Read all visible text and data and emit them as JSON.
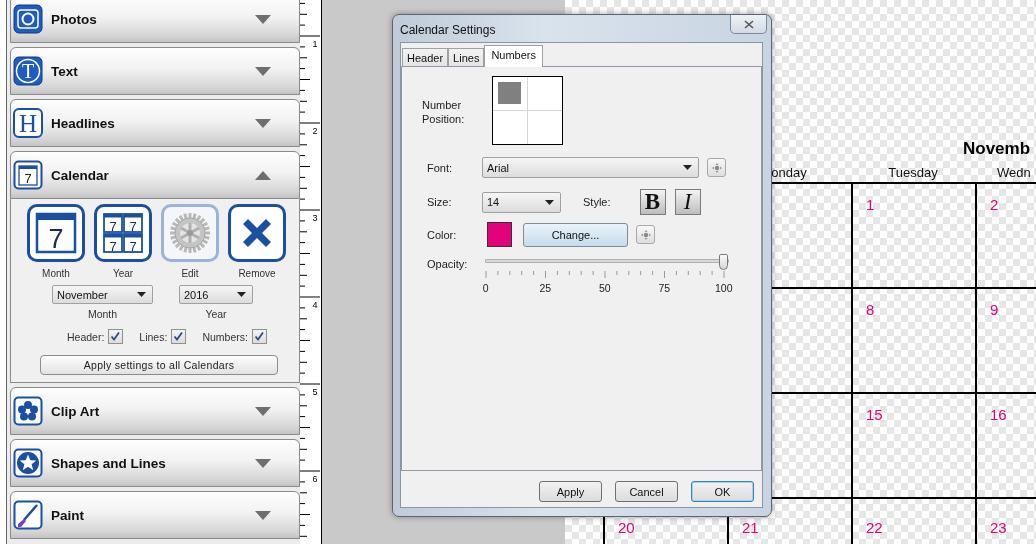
{
  "sidebar": {
    "panels": [
      {
        "title": "Photos",
        "kind": "camera",
        "expanded": false
      },
      {
        "title": "Text",
        "kind": "letter",
        "glyph": "T",
        "expanded": false
      },
      {
        "title": "Headlines",
        "kind": "headline",
        "glyph": "H",
        "expanded": false
      },
      {
        "title": "Calendar",
        "kind": "calendar",
        "glyph": "7",
        "expanded": true,
        "content": {
          "tools": [
            {
              "label": "Month",
              "kind": "month",
              "glyphs": [
                "7"
              ],
              "disabled": false
            },
            {
              "label": "Year",
              "kind": "year",
              "glyphs": [
                "7",
                "7",
                "7",
                "7"
              ],
              "disabled": false
            },
            {
              "label": "Edit",
              "kind": "gear",
              "disabled": true
            },
            {
              "label": "Remove",
              "kind": "remove",
              "disabled": false
            }
          ],
          "selects": [
            {
              "value": "November",
              "label": "Month"
            },
            {
              "value": "2016",
              "label": "Year"
            }
          ],
          "checkboxes": [
            {
              "label": "Header:",
              "checked": true
            },
            {
              "label": "Lines:",
              "checked": true
            },
            {
              "label": "Numbers:",
              "checked": true
            }
          ],
          "apply_button": "Apply settings to all Calendars"
        }
      },
      {
        "title": "Clip Art",
        "kind": "flower",
        "expanded": false
      },
      {
        "title": "Shapes and Lines",
        "kind": "star",
        "expanded": false
      },
      {
        "title": "Paint",
        "kind": "brush",
        "expanded": false
      }
    ]
  },
  "ruler": {
    "numbers": [
      "1",
      "2",
      "3",
      "4",
      "5",
      "6"
    ]
  },
  "calendar": {
    "title": "Novemb",
    "weekdays": [
      {
        "kind": "blank"
      },
      {
        "kind": "label",
        "text": "onday"
      },
      {
        "kind": "label",
        "text": "Tuesday"
      },
      {
        "kind": "label",
        "text": "Wedn"
      }
    ],
    "weeks": [
      [
        {
          "kind": "blank"
        },
        {
          "kind": "blank"
        },
        {
          "kind": "day",
          "number": "1"
        },
        {
          "kind": "day",
          "number": "2"
        }
      ],
      [
        {
          "kind": "blank"
        },
        {
          "kind": "blank"
        },
        {
          "kind": "day",
          "number": "8"
        },
        {
          "kind": "day",
          "number": "9"
        }
      ],
      [
        {
          "kind": "blank"
        },
        {
          "kind": "blank"
        },
        {
          "kind": "day",
          "number": "15"
        },
        {
          "kind": "day",
          "number": "16"
        }
      ],
      [
        {
          "kind": "day",
          "number": "20"
        },
        {
          "kind": "day",
          "number": "21"
        },
        {
          "kind": "day",
          "number": "22"
        },
        {
          "kind": "day",
          "number": "23"
        }
      ]
    ]
  },
  "dialog": {
    "title": "Calendar Settings",
    "tabs": [
      {
        "label": "Header",
        "selected": false
      },
      {
        "label": "Lines",
        "selected": false
      },
      {
        "label": "Numbers",
        "selected": true
      }
    ],
    "position_label": "Number Position:",
    "position_cells": [
      {
        "selected": true
      },
      {
        "selected": false
      },
      {
        "selected": false
      },
      {
        "selected": false
      }
    ],
    "font": {
      "label": "Font:",
      "value": "Arial"
    },
    "size": {
      "label": "Size:",
      "value": "14"
    },
    "style_label": "Style:",
    "style_buttons": [
      {
        "kind": "bold",
        "glyph": "B"
      },
      {
        "kind": "italic",
        "glyph": "I"
      }
    ],
    "color": {
      "label": "Color:",
      "color": "#e0037a",
      "button": "Change..."
    },
    "opacity": {
      "label": "Opacity:",
      "level": 1,
      "ticks": [
        "0",
        "25",
        "50",
        "75",
        "100"
      ]
    },
    "buttons": [
      {
        "label": "Apply",
        "default": false
      },
      {
        "label": "Cancel",
        "default": false
      },
      {
        "label": "OK",
        "default": true
      }
    ]
  }
}
